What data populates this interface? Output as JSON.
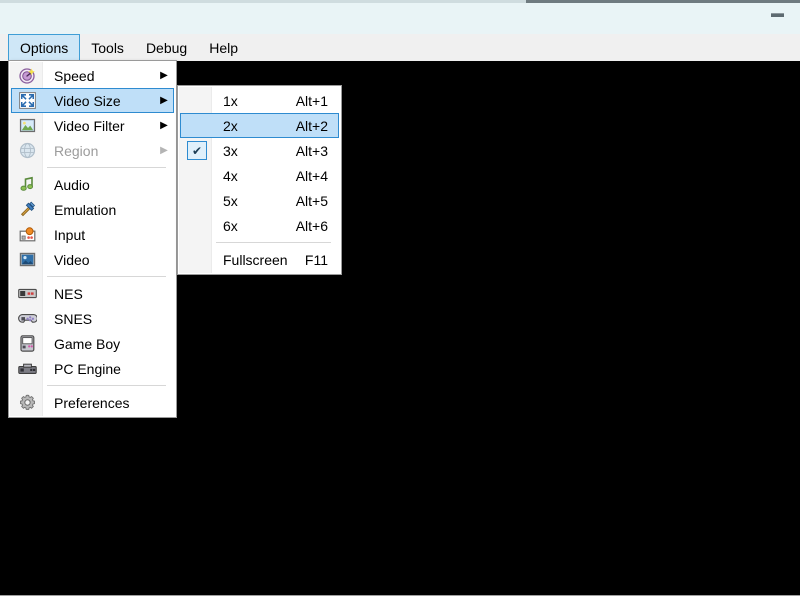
{
  "window": {
    "title": "",
    "minimize_label": "Minimize",
    "minimize_icon": "minimize-icon",
    "content_color": "#000000",
    "titlebar_color": "#e9f4f6"
  },
  "colors": {
    "accent": "#2e8bd0",
    "highlight_fill": "#bfdff8",
    "menubar_bg": "#f0f0f0",
    "menu_bg": "#ffffff",
    "gutter_bg": "#f4f4f4",
    "disabled_text": "#9c9c9c"
  },
  "menubar": {
    "items": [
      {
        "label": "Options",
        "active": true
      },
      {
        "label": "Tools",
        "active": false
      },
      {
        "label": "Debug",
        "active": false
      },
      {
        "label": "Help",
        "active": false
      }
    ]
  },
  "options_menu": {
    "items": [
      {
        "label": "Speed",
        "icon": "speed-icon",
        "submenu": true,
        "disabled": false,
        "highlight": false
      },
      {
        "label": "Video Size",
        "icon": "video-size-icon",
        "submenu": true,
        "disabled": false,
        "highlight": true
      },
      {
        "label": "Video Filter",
        "icon": "video-filter-icon",
        "submenu": true,
        "disabled": false,
        "highlight": false
      },
      {
        "label": "Region",
        "icon": "region-globe-icon",
        "submenu": true,
        "disabled": true,
        "highlight": false
      },
      {
        "separator": true
      },
      {
        "label": "Audio",
        "icon": "audio-icon",
        "submenu": false,
        "disabled": false,
        "highlight": false
      },
      {
        "label": "Emulation",
        "icon": "emulation-icon",
        "submenu": false,
        "disabled": false,
        "highlight": false
      },
      {
        "label": "Input",
        "icon": "input-icon",
        "submenu": false,
        "disabled": false,
        "highlight": false
      },
      {
        "label": "Video",
        "icon": "video-icon",
        "submenu": false,
        "disabled": false,
        "highlight": false
      },
      {
        "separator": true
      },
      {
        "label": "NES",
        "icon": "nes-controller-icon",
        "submenu": false,
        "disabled": false,
        "highlight": false
      },
      {
        "label": "SNES",
        "icon": "snes-controller-icon",
        "submenu": false,
        "disabled": false,
        "highlight": false
      },
      {
        "label": "Game Boy",
        "icon": "game-boy-icon",
        "submenu": false,
        "disabled": false,
        "highlight": false
      },
      {
        "label": "PC Engine",
        "icon": "pc-engine-icon",
        "submenu": false,
        "disabled": false,
        "highlight": false
      },
      {
        "separator": true
      },
      {
        "label": "Preferences",
        "icon": "gear-icon",
        "submenu": false,
        "disabled": false,
        "highlight": false
      }
    ]
  },
  "video_size_menu": {
    "items": [
      {
        "label": "1x",
        "accel": "Alt+1",
        "checked": false,
        "highlight": false
      },
      {
        "label": "2x",
        "accel": "Alt+2",
        "checked": false,
        "highlight": true
      },
      {
        "label": "3x",
        "accel": "Alt+3",
        "checked": true,
        "highlight": false
      },
      {
        "label": "4x",
        "accel": "Alt+4",
        "checked": false,
        "highlight": false
      },
      {
        "label": "5x",
        "accel": "Alt+5",
        "checked": false,
        "highlight": false
      },
      {
        "label": "6x",
        "accel": "Alt+6",
        "checked": false,
        "highlight": false
      },
      {
        "separator": true
      },
      {
        "label": "Fullscreen",
        "accel": "F11",
        "checked": false,
        "highlight": false
      }
    ],
    "check_glyph": "✔",
    "submenu_arrow_glyph": "▶"
  }
}
